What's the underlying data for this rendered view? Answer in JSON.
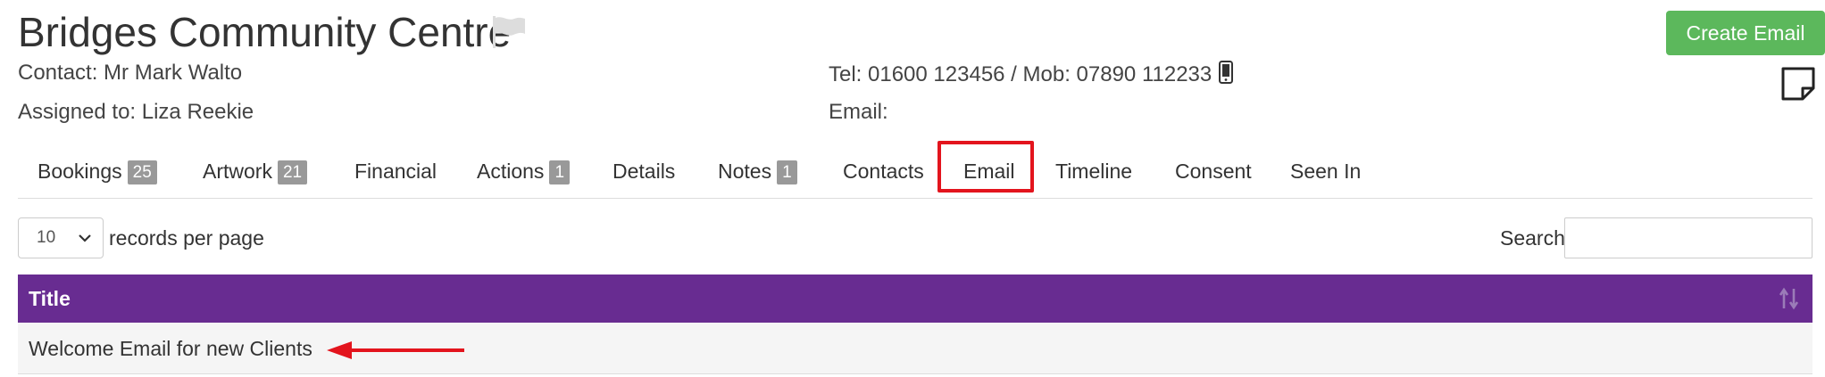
{
  "header": {
    "title": "Bridges Community Centre",
    "contact": "Contact: Mr Mark Walto",
    "assigned": "Assigned to: Liza Reekie",
    "phones": "Tel: 01600 123456 / Mob: 07890 112233",
    "email": "Email:",
    "create_email_label": "Create Email"
  },
  "tabs": [
    {
      "label": "Bookings",
      "badge": "25"
    },
    {
      "label": "Artwork",
      "badge": "21"
    },
    {
      "label": "Financial"
    },
    {
      "label": "Actions",
      "badge": "1"
    },
    {
      "label": "Details"
    },
    {
      "label": "Notes",
      "badge": "1"
    },
    {
      "label": "Contacts"
    },
    {
      "label": "Email",
      "active": true
    },
    {
      "label": "Timeline"
    },
    {
      "label": "Consent"
    },
    {
      "label": "Seen In"
    }
  ],
  "table_controls": {
    "page_length": "10",
    "records_label": "records per page",
    "search_label": "Search:",
    "search_value": ""
  },
  "table": {
    "columns": [
      "Title"
    ],
    "rows": [
      [
        "Welcome Email for new Clients"
      ]
    ]
  },
  "colors": {
    "header_purple": "#682c91",
    "create_green": "#5cb85c",
    "highlight_red": "#e3141d",
    "badge_gray": "#999999"
  },
  "icons": [
    "flag-icon",
    "mobile-phone-icon",
    "sticky-note-icon",
    "sort-icon",
    "chevron-down-icon",
    "arrow-left-icon"
  ]
}
